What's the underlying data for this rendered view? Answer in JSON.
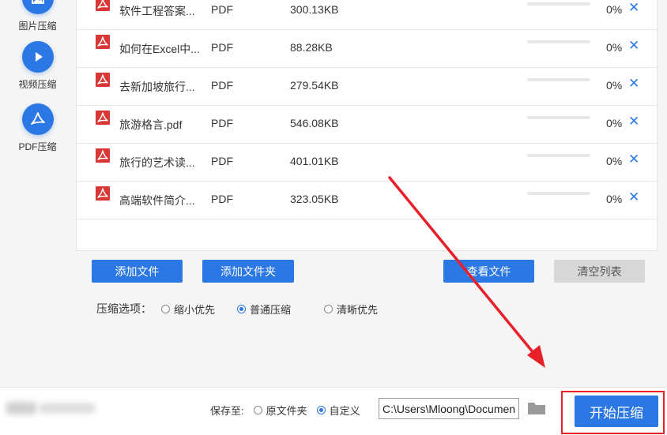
{
  "sidebar": {
    "items": [
      {
        "label": "图片压缩",
        "icon": "image-compress-icon"
      },
      {
        "label": "视频压缩",
        "icon": "play-icon"
      },
      {
        "label": "PDF压缩",
        "icon": "pdf-icon"
      }
    ]
  },
  "files": [
    {
      "name": "软件工程答案...",
      "type": "PDF",
      "size": "300.13KB",
      "progress": 0,
      "pct": "0%"
    },
    {
      "name": "如何在Excel中...",
      "type": "PDF",
      "size": "88.28KB",
      "progress": 0,
      "pct": "0%"
    },
    {
      "name": "去新加坡旅行...",
      "type": "PDF",
      "size": "279.54KB",
      "progress": 0,
      "pct": "0%"
    },
    {
      "name": "旅游格言.pdf",
      "type": "PDF",
      "size": "546.08KB",
      "progress": 0,
      "pct": "0%"
    },
    {
      "name": "旅行的艺术读...",
      "type": "PDF",
      "size": "401.01KB",
      "progress": 0,
      "pct": "0%"
    },
    {
      "name": "高端软件简介...",
      "type": "PDF",
      "size": "323.05KB",
      "progress": 0,
      "pct": "0%"
    }
  ],
  "actions": {
    "add_file": "添加文件",
    "add_folder": "添加文件夹",
    "view_files": "查看文件",
    "clear_list": "清空列表"
  },
  "compress": {
    "label": "压缩选项：",
    "options": [
      "缩小优先",
      "普通压缩",
      "清晰优先"
    ],
    "selected": "普通压缩"
  },
  "save": {
    "label": "保存至:",
    "options": [
      "原文件夹",
      "自定义"
    ],
    "selected": "自定义",
    "path": "C:\\Users\\Mloong\\Documents"
  },
  "start_button": "开始压缩",
  "colors": {
    "accent": "#2b78e4",
    "annotation": "#e8202a"
  }
}
